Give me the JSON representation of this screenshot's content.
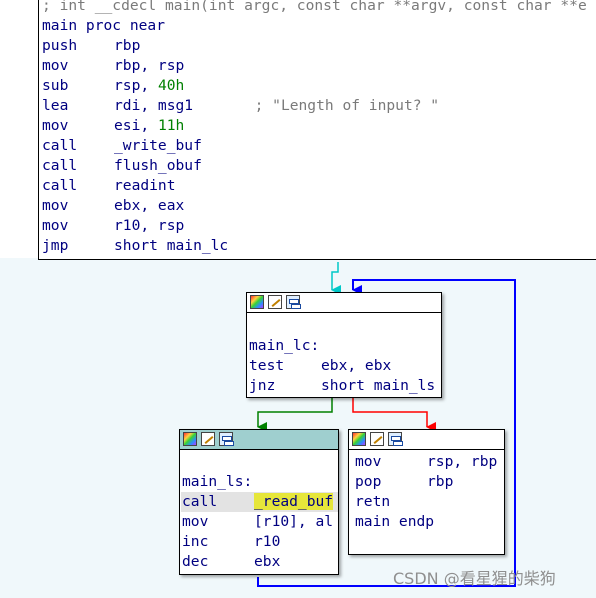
{
  "top_block": {
    "lines": [
      {
        "c0": "; int __cdecl main(int argc, const char **argv, const char **e",
        "c1": "",
        "c2": ""
      },
      {
        "c0": "main proc near",
        "c1": "",
        "c2": ""
      },
      {
        "c0": "push",
        "c1": "rbp",
        "c2": ""
      },
      {
        "c0": "mov",
        "c1": "rbp, rsp",
        "c2": ""
      },
      {
        "c0": "sub",
        "c1": "rsp, ",
        "c2": "40h"
      },
      {
        "c0": "lea",
        "c1": "rdi, msg1",
        "c2": "       ; \"Length of input? \""
      },
      {
        "c0": "mov",
        "c1": "esi, ",
        "c2": "11h"
      },
      {
        "c0": "call",
        "c1": "_write_buf",
        "c2": ""
      },
      {
        "c0": "call",
        "c1": "flush_obuf",
        "c2": ""
      },
      {
        "c0": "call",
        "c1": "readint",
        "c2": ""
      },
      {
        "c0": "mov",
        "c1": "ebx, eax",
        "c2": ""
      },
      {
        "c0": "mov",
        "c1": "r10, rsp",
        "c2": ""
      },
      {
        "c0": "jmp",
        "c1": "short main_lc",
        "c2": ""
      }
    ]
  },
  "node_main_lc": {
    "label": "main_lc:",
    "lines": [
      {
        "c0": "test",
        "c1": "ebx, ebx"
      },
      {
        "c0": "jnz",
        "c1": "short main_ls"
      }
    ]
  },
  "node_main_ls": {
    "label": "main_ls:",
    "lines": [
      {
        "c0": "call",
        "c1": "_read_buf"
      },
      {
        "c0": "mov",
        "c1": "[r10], al"
      },
      {
        "c0": "inc",
        "c1": "r10"
      },
      {
        "c0": "dec",
        "c1": "ebx"
      }
    ]
  },
  "node_exit": {
    "lines": [
      {
        "c0": "mov",
        "c1": "rsp, rbp"
      },
      {
        "c0": "pop",
        "c1": "rbp"
      },
      {
        "c0": "retn",
        "c1": ""
      },
      {
        "c0": "main endp",
        "c1": ""
      }
    ]
  },
  "header_icons": [
    "color-palette-icon",
    "rename-icon",
    "graph-overview-icon"
  ],
  "edge_colors": {
    "true": "#008000",
    "false": "#ff0000",
    "unconditional": "#0000ff",
    "entry": "#00c8c8"
  },
  "watermark": "CSDN @看星猩的柴狗"
}
